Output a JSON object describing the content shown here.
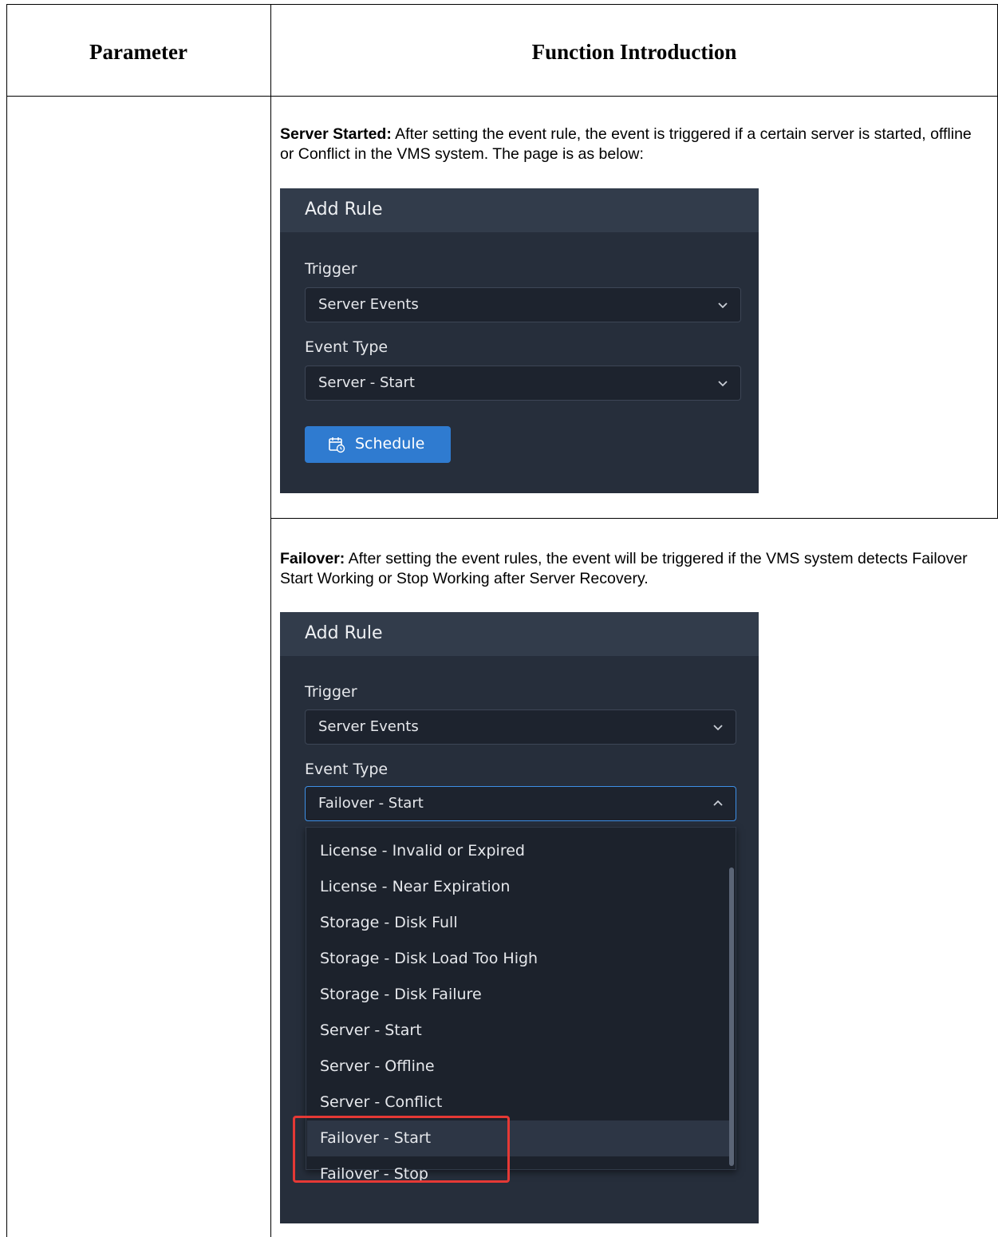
{
  "table": {
    "header": {
      "parameter": "Parameter",
      "function": "Function Introduction"
    }
  },
  "rows": [
    {
      "desc_bold": "Server Started:",
      "desc_text": " After setting the event rule, the event is triggered if a certain server is started, offline or Conflict in the VMS system. The page is as below:",
      "dialog": {
        "title": "Add Rule",
        "trigger_label": "Trigger",
        "trigger_value": "Server Events",
        "event_type_label": "Event Type",
        "event_type_value": "Server - Start",
        "schedule_label": "Schedule"
      }
    },
    {
      "desc_bold": "Failover:",
      "desc_text": " After setting the event rules, the event will be triggered if the VMS system detects Failover Start Working or Stop Working after Server Recovery.",
      "dialog": {
        "title": "Add Rule",
        "trigger_label": "Trigger",
        "trigger_value": "Server Events",
        "event_type_label": "Event Type",
        "event_type_value": "Failover - Start",
        "options": [
          "License - Invalid or Expired",
          "License - Near Expiration",
          "Storage - Disk Full",
          "Storage - Disk Load Too High",
          "Storage - Disk Failure",
          "Server - Start",
          "Server - Offline",
          "Server - Conflict",
          "Failover - Start",
          "Failover - Stop"
        ],
        "highlighted_option": "Failover - Start"
      }
    }
  ],
  "colors": {
    "panel_bg": "#262e3b",
    "panel_header": "#323c4b",
    "accent_blue": "#2f7bd0",
    "highlight_red": "#e53935"
  }
}
